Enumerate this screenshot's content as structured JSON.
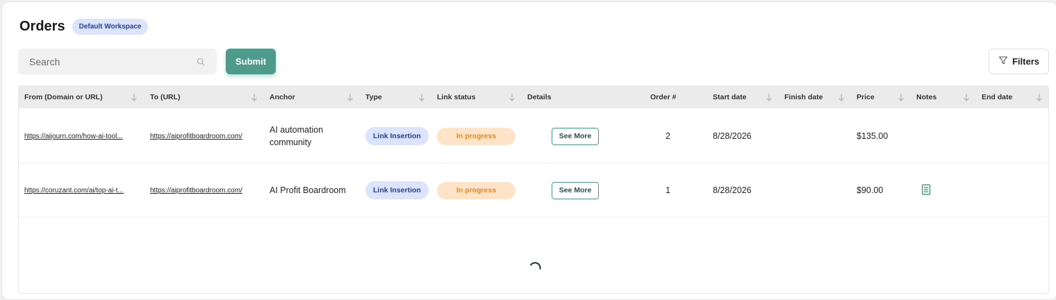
{
  "header": {
    "title": "Orders",
    "workspace_badge": "Default Workspace"
  },
  "search": {
    "placeholder": "Search",
    "value": ""
  },
  "toolbar": {
    "submit_label": "Submit",
    "filters_label": "Filters"
  },
  "colors": {
    "accent": "#4e9b8c",
    "type_pill_bg": "#dbe4fb",
    "status_pill_bg": "#fde3c8",
    "status_pill_text": "#e58a2a"
  },
  "table": {
    "columns": [
      "From (Domain or URL)",
      "To (URL)",
      "Anchor",
      "Type",
      "Link status",
      "Details",
      "Order #",
      "Start date",
      "Finish date",
      "Price",
      "Notes",
      "End date"
    ],
    "rows": [
      {
        "from": "https://aijourn.com/how-ai-tool...",
        "to": "https://aiprofitboardroom.com/",
        "anchor": "AI automation community",
        "type": "Link Insertion",
        "status": "In progress",
        "details": "See More",
        "order": "2",
        "start_date": "8/28/2026",
        "finish_date": "",
        "price": "$135.00",
        "notes_icon": "",
        "end_date": ""
      },
      {
        "from": "https://coruzant.com/ai/top-ai-t...",
        "to": "https://aiprofitboardroom.com/",
        "anchor": "AI Profit Boardroom",
        "type": "Link Insertion",
        "status": "In progress",
        "details": "See More",
        "order": "1",
        "start_date": "8/28/2026",
        "finish_date": "",
        "price": "$90.00",
        "notes_icon": "note-icon",
        "end_date": ""
      }
    ]
  },
  "icons": {
    "search": "search-icon",
    "filters": "filter-icon",
    "sort": "sort-arrow-icon",
    "loading": "loading-spinner-icon"
  }
}
